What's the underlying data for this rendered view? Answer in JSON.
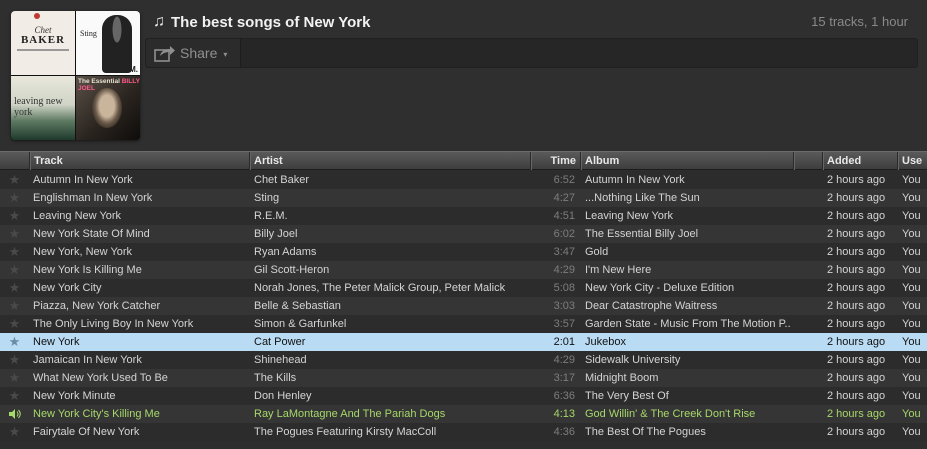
{
  "playlist": {
    "title": "The best songs of New York",
    "summary": "15 tracks, 1 hour",
    "cover_texts": {
      "chet": "Chet",
      "baker": "BAKER",
      "sting": "Sting",
      "rem": "R.E.M.",
      "leaving": "leaving new york",
      "essential": "The Essential",
      "billy": "BILLY JOEL"
    }
  },
  "share": {
    "label": "Share",
    "caret": "▾"
  },
  "icons": {
    "note": "music-note-icon",
    "share": "share-arrow-icon",
    "star": "star-icon",
    "speaker": "speaker-icon"
  },
  "colors": {
    "selected": "#b9dbf4",
    "playing": "#a6d86a"
  },
  "columns": {
    "track": "Track",
    "artist": "Artist",
    "time": "Time",
    "album": "Album",
    "added": "Added",
    "user": "Use"
  },
  "tracks": [
    {
      "track": "Autumn In New York",
      "artist": "Chet Baker",
      "time": "6:52",
      "album": "Autumn In New York",
      "added": "2 hours ago",
      "user": "You",
      "state": ""
    },
    {
      "track": "Englishman In New York",
      "artist": "Sting",
      "time": "4:27",
      "album": "...Nothing Like The Sun",
      "added": "2 hours ago",
      "user": "You",
      "state": ""
    },
    {
      "track": "Leaving New York",
      "artist": "R.E.M.",
      "time": "4:51",
      "album": "Leaving New York",
      "added": "2 hours ago",
      "user": "You",
      "state": ""
    },
    {
      "track": "New York State Of Mind",
      "artist": "Billy Joel",
      "time": "6:02",
      "album": "The Essential Billy Joel",
      "added": "2 hours ago",
      "user": "You",
      "state": ""
    },
    {
      "track": "New York, New York",
      "artist": "Ryan Adams",
      "time": "3:47",
      "album": "Gold",
      "added": "2 hours ago",
      "user": "You",
      "state": ""
    },
    {
      "track": "New York Is Killing Me",
      "artist": "Gil Scott-Heron",
      "time": "4:29",
      "album": "I'm New Here",
      "added": "2 hours ago",
      "user": "You",
      "state": ""
    },
    {
      "track": "New York City",
      "artist": "Norah Jones, The Peter Malick Group, Peter Malick",
      "time": "5:08",
      "album": "New York City - Deluxe Edition",
      "added": "2 hours ago",
      "user": "You",
      "state": ""
    },
    {
      "track": "Piazza, New York Catcher",
      "artist": "Belle & Sebastian",
      "time": "3:03",
      "album": "Dear Catastrophe Waitress",
      "added": "2 hours ago",
      "user": "You",
      "state": ""
    },
    {
      "track": "The Only Living Boy In New York",
      "artist": "Simon & Garfunkel",
      "time": "3:57",
      "album": "Garden State - Music From The Motion P...",
      "added": "2 hours ago",
      "user": "You",
      "state": ""
    },
    {
      "track": "New York",
      "artist": "Cat Power",
      "time": "2:01",
      "album": "Jukebox",
      "added": "2 hours ago",
      "user": "You",
      "state": "selected"
    },
    {
      "track": "Jamaican In New York",
      "artist": "Shinehead",
      "time": "4:29",
      "album": "Sidewalk University",
      "added": "2 hours ago",
      "user": "You",
      "state": ""
    },
    {
      "track": "What New York Used To Be",
      "artist": "The Kills",
      "time": "3:17",
      "album": "Midnight Boom",
      "added": "2 hours ago",
      "user": "You",
      "state": ""
    },
    {
      "track": "New York Minute",
      "artist": "Don Henley",
      "time": "6:36",
      "album": "The Very Best Of",
      "added": "2 hours ago",
      "user": "You",
      "state": ""
    },
    {
      "track": "New York City's Killing Me",
      "artist": "Ray LaMontagne And The Pariah Dogs",
      "time": "4:13",
      "album": "God Willin' & The Creek Don't Rise",
      "added": "2 hours ago",
      "user": "You",
      "state": "playing"
    },
    {
      "track": "Fairytale Of New York",
      "artist": "The Pogues Featuring Kirsty MacColl",
      "time": "4:36",
      "album": "The Best Of The Pogues",
      "added": "2 hours ago",
      "user": "You",
      "state": ""
    }
  ]
}
